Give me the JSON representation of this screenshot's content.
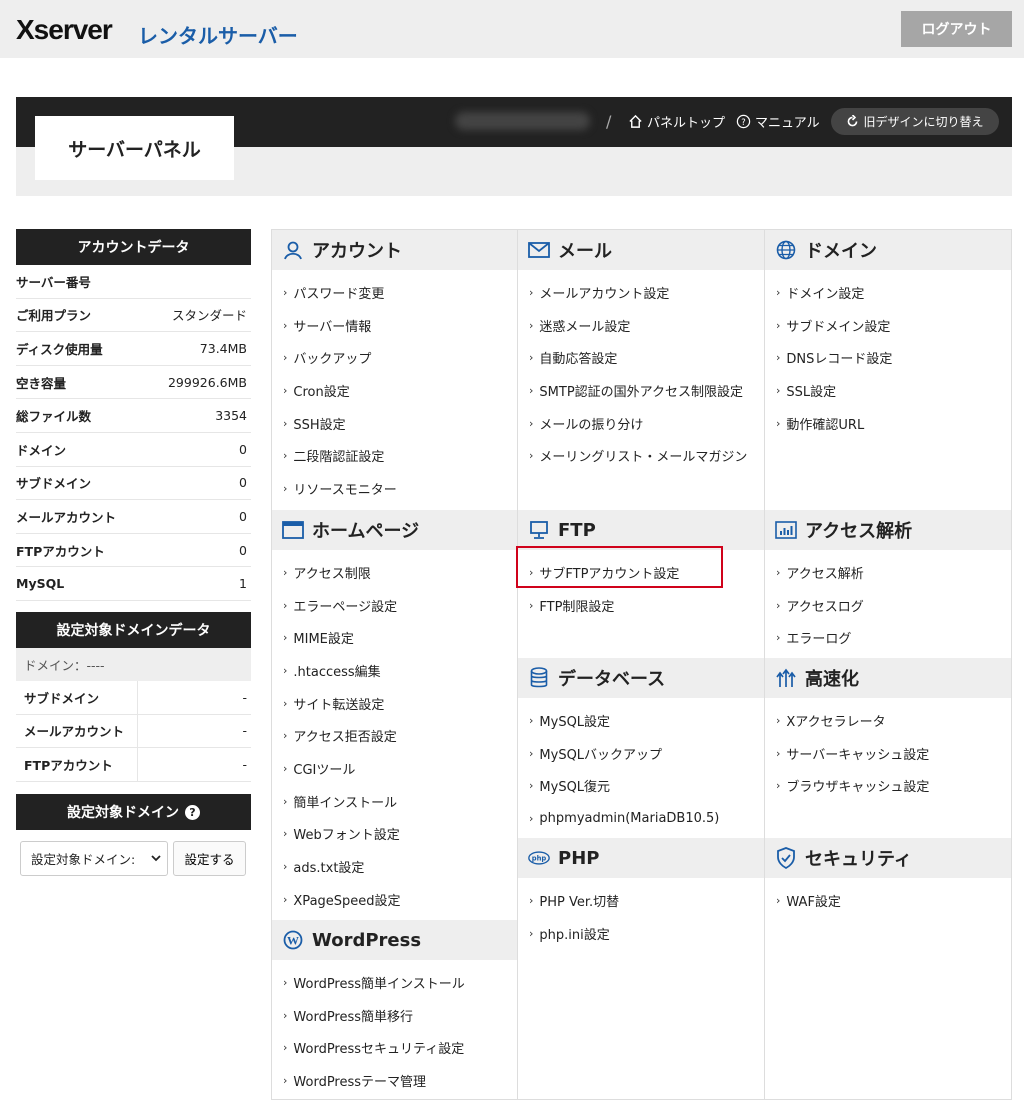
{
  "header": {
    "logo": "Xserver",
    "logo_sub": "レンタルサーバー",
    "logout": "ログアウト"
  },
  "panel": {
    "title": "サーバーパネル",
    "nav": [
      {
        "icon": "home-icon",
        "label": "パネルトップ"
      },
      {
        "icon": "question-circle-icon",
        "label": "マニュアル"
      }
    ],
    "old_design": "旧デザインに切り替え"
  },
  "account_data": {
    "title": "アカウントデータ",
    "rows": [
      {
        "label": "サーバー番号",
        "value": ""
      },
      {
        "label": "ご利用プラン",
        "value": "スタンダード"
      },
      {
        "label": "ディスク使用量",
        "value": "73.4MB"
      },
      {
        "label": "空き容量",
        "value": "299926.6MB"
      },
      {
        "label": "総ファイル数",
        "value": "3354"
      },
      {
        "label": "ドメイン",
        "value": "0"
      },
      {
        "label": "サブドメイン",
        "value": "0"
      },
      {
        "label": "メールアカウント",
        "value": "0"
      },
      {
        "label": "FTPアカウント",
        "value": "0"
      },
      {
        "label": "MySQL",
        "value": "1"
      }
    ]
  },
  "domain_data": {
    "title": "設定対象ドメインデータ",
    "domain_row": "ドメイン：----",
    "rows": [
      {
        "label": "サブドメイン",
        "value": "-"
      },
      {
        "label": "メールアカウント",
        "value": "-"
      },
      {
        "label": "FTPアカウント",
        "value": "-"
      }
    ]
  },
  "target_domain": {
    "title": "設定対象ドメイン",
    "help": "?",
    "select_value": "設定対象ドメイン:",
    "button": "設定する"
  },
  "menu": {
    "col1": [
      {
        "title": "アカウント",
        "icon": "user-icon",
        "items": [
          "パスワード変更",
          "サーバー情報",
          "バックアップ",
          "Cron設定",
          "SSH設定",
          "二段階認証設定",
          "リソースモニター"
        ]
      },
      {
        "title": "ホームページ",
        "icon": "browser-window-icon",
        "items": [
          "アクセス制限",
          "エラーページ設定",
          "MIME設定",
          ".htaccess編集",
          "サイト転送設定",
          "アクセス拒否設定",
          "CGIツール",
          "簡単インストール",
          "Webフォント設定",
          "ads.txt設定",
          "XPageSpeed設定"
        ]
      },
      {
        "title": "WordPress",
        "icon": "wordpress-icon",
        "items": [
          "WordPress簡単インストール",
          "WordPress簡単移行",
          "WordPressセキュリティ設定",
          "WordPressテーマ管理"
        ]
      }
    ],
    "col2": [
      {
        "title": "メール",
        "icon": "envelope-icon",
        "items": [
          "メールアカウント設定",
          "迷惑メール設定",
          "自動応答設定",
          "SMTP認証の国外アクセス制限設定",
          "メールの振り分け",
          "メーリングリスト・メールマガジン"
        ]
      },
      {
        "title": "FTP",
        "icon": "monitor-icon",
        "items": [
          "サブFTPアカウント設定",
          "FTP制限設定"
        ]
      },
      {
        "title": "データベース",
        "icon": "database-icon",
        "items": [
          "MySQL設定",
          "MySQLバックアップ",
          "MySQL復元",
          "phpmyadmin(MariaDB10.5)"
        ]
      },
      {
        "title": "PHP",
        "icon": "php-icon",
        "items": [
          "PHP Ver.切替",
          "php.ini設定"
        ]
      }
    ],
    "col3": [
      {
        "title": "ドメイン",
        "icon": "globe-icon",
        "items": [
          "ドメイン設定",
          "サブドメイン設定",
          "DNSレコード設定",
          "SSL設定",
          "動作確認URL"
        ]
      },
      {
        "title": "アクセス解析",
        "icon": "bar-chart-icon",
        "items": [
          "アクセス解析",
          "アクセスログ",
          "エラーログ"
        ]
      },
      {
        "title": "高速化",
        "icon": "speed-arrows-icon",
        "items": [
          "Xアクセラレータ",
          "サーバーキャッシュ設定",
          "ブラウザキャッシュ設定"
        ]
      },
      {
        "title": "セキュリティ",
        "icon": "shield-icon",
        "items": [
          "WAF設定"
        ]
      }
    ]
  },
  "chevron": "›",
  "colors": {
    "accent": "#1a5da8",
    "highlight": "#d0021b"
  }
}
